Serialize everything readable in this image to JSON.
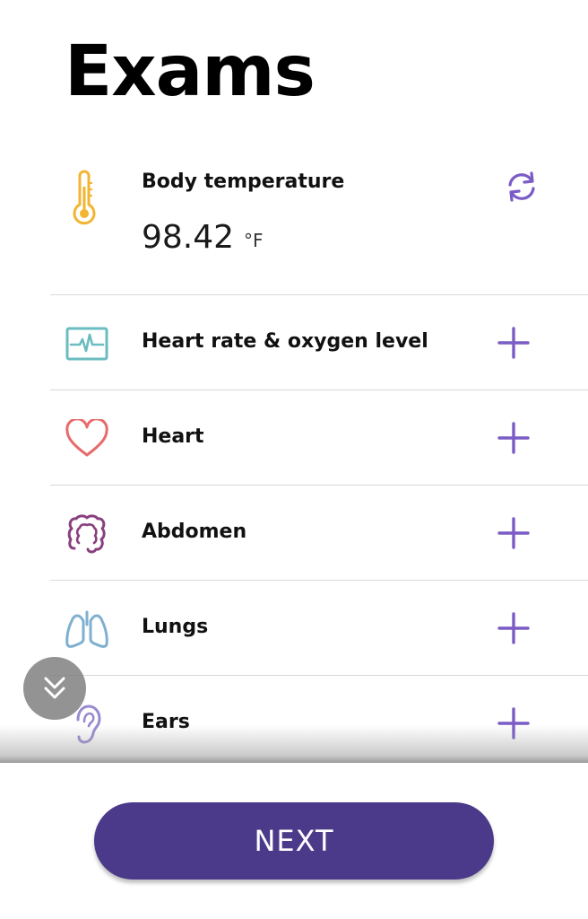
{
  "page": {
    "title": "Exams"
  },
  "temperature": {
    "label": "Body temperature",
    "value": "98.42",
    "unit": "°F",
    "icon": "thermometer-icon",
    "action_icon": "refresh-icon"
  },
  "exams": [
    {
      "label": "Heart rate & oxygen level",
      "icon": "pulse-monitor-icon"
    },
    {
      "label": "Heart",
      "icon": "heart-icon"
    },
    {
      "label": "Abdomen",
      "icon": "intestine-icon"
    },
    {
      "label": "Lungs",
      "icon": "lungs-icon"
    },
    {
      "label": "Ears",
      "icon": "ear-icon"
    }
  ],
  "footer": {
    "next_label": "NEXT"
  },
  "colors": {
    "accent": "#7b5cc6",
    "button": "#4b3a8a",
    "thermometer": "#f2b531",
    "pulse": "#6bbcc0",
    "heart": "#e76b6b",
    "abdomen": "#8a3f7e",
    "lungs": "#7fb0cf",
    "ear": "#9a8ad0"
  }
}
